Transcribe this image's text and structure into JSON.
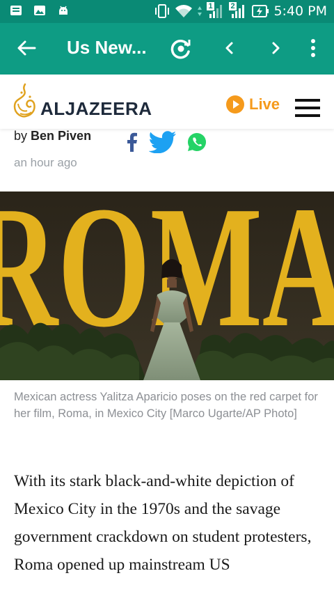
{
  "status_bar": {
    "time": "5:40 PM",
    "sim1": "1",
    "sim2": "2",
    "icons": [
      "notification-icon",
      "gallery-icon",
      "android-icon",
      "vibrate-icon",
      "wifi-icon",
      "signal-icon",
      "signal-icon",
      "battery-charging-icon"
    ]
  },
  "toolbar": {
    "title": "Us New...",
    "back_icon": "arrow-left-icon",
    "refresh_icon": "refresh-icon",
    "prev_icon": "chevron-left-icon",
    "next_icon": "chevron-right-icon",
    "more_icon": "more-vertical-icon"
  },
  "site_header": {
    "logo_text": "ALJAZEERA",
    "live_label": "Live",
    "menu_icon": "hamburger-icon"
  },
  "byline": {
    "prefix": "by",
    "author": "Ben Piven",
    "time_ago": "an hour ago",
    "share_icons": [
      "facebook-icon",
      "twitter-icon",
      "whatsapp-icon"
    ]
  },
  "photo": {
    "sign_text": "ROMA"
  },
  "caption": "Mexican actress Yalitza Aparicio poses on the red carpet for her film, Roma, in Mexico City [Marco Ugarte/AP Photo]",
  "article_text": "With its stark black-and-white depiction of Mexico City in the 1970s and the savage government crackdown on student protesters, Roma opened up mainstream US",
  "colors": {
    "status_bar": "#0a8a75",
    "toolbar": "#0e9c84",
    "accent_orange": "#f59a1c",
    "logo_gold": "#e0a21f",
    "facebook": "#3b5998",
    "twitter": "#1da1f2",
    "whatsapp": "#25d366"
  }
}
